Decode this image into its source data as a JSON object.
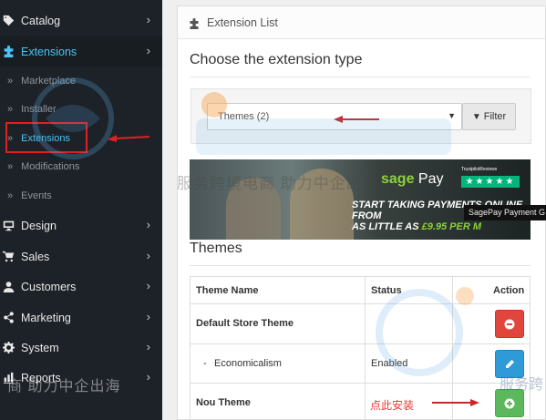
{
  "sidebar": {
    "items": [
      {
        "label": "Catalog",
        "icon": "tag-icon"
      },
      {
        "label": "Extensions",
        "icon": "puzzle-icon"
      },
      {
        "label": "Design",
        "icon": "monitor-icon"
      },
      {
        "label": "Sales",
        "icon": "cart-icon"
      },
      {
        "label": "Customers",
        "icon": "user-icon"
      },
      {
        "label": "Marketing",
        "icon": "share-icon"
      },
      {
        "label": "System",
        "icon": "gear-icon"
      },
      {
        "label": "Reports",
        "icon": "bar-chart-icon"
      }
    ],
    "sub_items": [
      {
        "label": "Marketplace"
      },
      {
        "label": "Installer"
      },
      {
        "label": "Extensions"
      },
      {
        "label": "Modifications"
      },
      {
        "label": "Events"
      }
    ],
    "chevron": "›",
    "bullet": "»"
  },
  "panel": {
    "heading": "Extension List",
    "choose_title": "Choose the extension type",
    "select_value": "Themes (2)",
    "filter_label": "Filter"
  },
  "banner": {
    "brand_sage": "sage",
    "brand_pay": "Pay",
    "trust_label": "TrustpilotReviews",
    "stars": "★★★★★",
    "promo_line1": "START TAKING PAYMENTS ONLINE FROM",
    "promo_line2a": "AS LITTLE AS ",
    "promo_money": "£9.95 PER M",
    "tooltip": "SagePay Payment G"
  },
  "themes": {
    "title": "Themes",
    "columns": [
      "Theme Name",
      "Status",
      "Action"
    ],
    "rows": [
      {
        "name": "Default Store Theme",
        "status": "",
        "action": "uninstall"
      },
      {
        "name": "Economicalism",
        "status": "Enabled",
        "action": "edit",
        "prefix": "-"
      },
      {
        "name": "Nou Theme",
        "status": "",
        "action": "install"
      }
    ]
  },
  "annotation": {
    "note": "点此安装"
  },
  "watermark": {
    "text1": "服务跨境电商  助力中企出海",
    "text2": "商  助力中企出海",
    "text3": "服务跨"
  },
  "colors": {
    "sidebar_bg": "#1d2228",
    "active_blue": "#4bc3f7",
    "btn_red": "#e0463c",
    "btn_blue": "#2e9ad8",
    "btn_green": "#5cb85c",
    "annotation_red": "#e53935"
  }
}
